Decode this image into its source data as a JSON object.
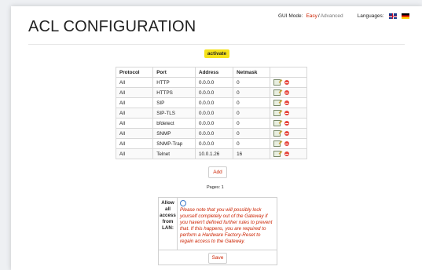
{
  "page": {
    "title": "ACL CONFIGURATION"
  },
  "header": {
    "gui_mode_label": "GUI Mode:",
    "mode_easy": "Easy",
    "mode_separator": "/",
    "mode_advanced": "Advanced",
    "languages_label": "Languages:",
    "flags": [
      "uk-flag-icon",
      "de-flag-icon"
    ]
  },
  "actions": {
    "activate_label": "activate",
    "add_label": "Add",
    "save_label": "Save"
  },
  "table": {
    "columns": [
      "Protocol",
      "Port",
      "Address",
      "Netmask"
    ],
    "rows": [
      {
        "protocol": "All",
        "port": "HTTP",
        "address": "0.0.0.0",
        "netmask": "0"
      },
      {
        "protocol": "All",
        "port": "HTTPS",
        "address": "0.0.0.0",
        "netmask": "0"
      },
      {
        "protocol": "All",
        "port": "SIP",
        "address": "0.0.0.0",
        "netmask": "0"
      },
      {
        "protocol": "All",
        "port": "SIP-TLS",
        "address": "0.0.0.0",
        "netmask": "0"
      },
      {
        "protocol": "All",
        "port": "bfdetect",
        "address": "0.0.0.0",
        "netmask": "0"
      },
      {
        "protocol": "All",
        "port": "SNMP",
        "address": "0.0.0.0",
        "netmask": "0"
      },
      {
        "protocol": "All",
        "port": "SNMP-Trap",
        "address": "0.0.0.0",
        "netmask": "0"
      },
      {
        "protocol": "All",
        "port": "Telnet",
        "address": "10.0.1.26",
        "netmask": "16"
      }
    ],
    "row_icons": [
      "edit-icon",
      "delete-icon"
    ]
  },
  "pagination": {
    "text": "Pages: 1"
  },
  "lan": {
    "label": "Allow all access from LAN:",
    "checked": false,
    "note": "Please note that you will possibly lock yourself completely out of the Gateway if you haven't defined further rules to prevent that. If this happens, you are required to perform a Hardware Factory-Reset to regain access to the Gateway."
  },
  "colors": {
    "accent": "#cc2200",
    "activate_bg": "#f5e21b",
    "delete": "#e5453c"
  }
}
